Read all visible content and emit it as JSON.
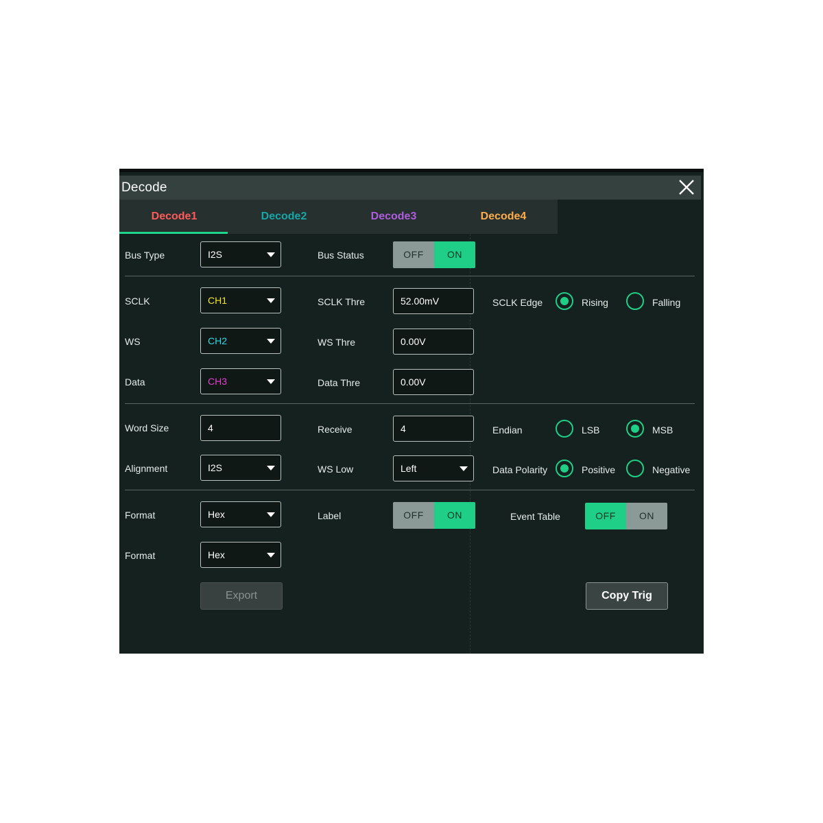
{
  "dialog": {
    "title": "Decode",
    "tabs": [
      {
        "label": "Decode1",
        "color": "#ff5a5a"
      },
      {
        "label": "Decode2",
        "color": "#16a7a8"
      },
      {
        "label": "Decode3",
        "color": "#b05ce0"
      },
      {
        "label": "Decode4",
        "color": "#ffad4a"
      }
    ]
  },
  "bus": {
    "type_label": "Bus Type",
    "type_value": "I2S",
    "status_label": "Bus Status",
    "status_off": "OFF",
    "status_on": "ON"
  },
  "sources": {
    "sclk_label": "SCLK",
    "sclk_value": "CH1",
    "sclk_color": "#f2e332",
    "ws_label": "WS",
    "ws_value": "CH2",
    "ws_color": "#2fd9e6",
    "data_label": "Data",
    "data_value": "CH3",
    "data_color": "#e23fd0"
  },
  "thresholds": {
    "sclk_label": "SCLK Thre",
    "sclk_value": "52.00mV",
    "ws_label": "WS Thre",
    "ws_value": "0.00V",
    "data_label": "Data Thre",
    "data_value": "0.00V"
  },
  "sclk_edge": {
    "label": "SCLK Edge",
    "rising": "Rising",
    "falling": "Falling",
    "selected": "Rising"
  },
  "word": {
    "size_label": "Word Size",
    "size_value": "4",
    "receive_label": "Receive",
    "receive_value": "4"
  },
  "endian": {
    "label": "Endian",
    "lsb": "LSB",
    "msb": "MSB",
    "selected": "MSB"
  },
  "alignment": {
    "label": "Alignment",
    "value": "I2S"
  },
  "ws_low": {
    "label": "WS Low",
    "value": "Left"
  },
  "polarity": {
    "label": "Data Polarity",
    "positive": "Positive",
    "negative": "Negative",
    "selected": "Positive"
  },
  "format1": {
    "label": "Format",
    "value": "Hex"
  },
  "format2": {
    "label": "Format",
    "value": "Hex"
  },
  "label_toggle": {
    "label": "Label",
    "off": "OFF",
    "on": "ON"
  },
  "event_table": {
    "label": "Event Table",
    "off": "OFF",
    "on": "ON"
  },
  "buttons": {
    "export": "Export",
    "copy_trig": "Copy Trig"
  },
  "accent_color": "#1fcf87"
}
